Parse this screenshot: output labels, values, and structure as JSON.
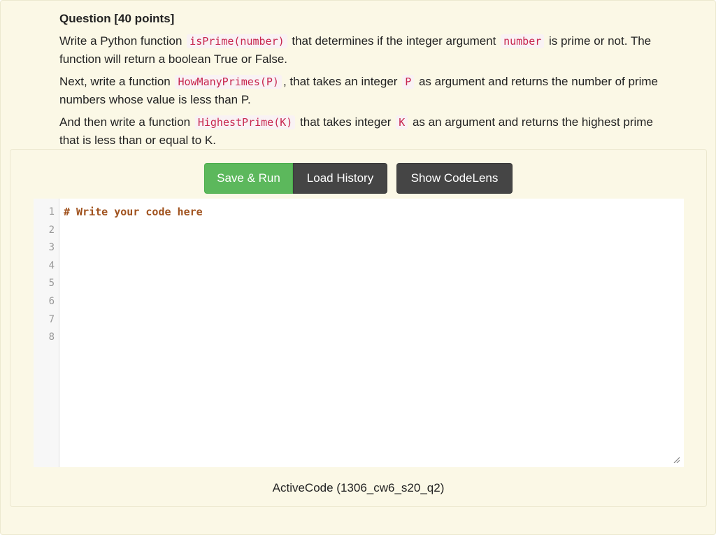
{
  "question": {
    "title": "Question [40 points]",
    "para1": {
      "t1": "Write a Python function ",
      "c1": "isPrime(number)",
      "t2": " that determines if the integer argument ",
      "c2": "number",
      "t3": " is prime or not. The function will return a boolean True or False."
    },
    "para2": {
      "t1": "Next, write a function ",
      "c1": "HowManyPrimes(P)",
      "t2": ", that takes an integer ",
      "c2": "P",
      "t3": " as argument and returns the number of prime numbers whose value is less than P."
    },
    "para3": {
      "t1": "And then write a function ",
      "c1": "HighestPrime(K)",
      "t2": " that takes integer ",
      "c2": "K",
      "t3": " as an argument and returns the highest prime that is less than or equal to K."
    }
  },
  "toolbar": {
    "save_run_label": "Save & Run",
    "load_history_label": "Load History",
    "show_codelens_label": "Show CodeLens"
  },
  "editor": {
    "line_numbers": [
      "1",
      "2",
      "3",
      "4",
      "5",
      "6",
      "7",
      "8"
    ],
    "lines": [
      "# Write your code here",
      "",
      "",
      "",
      "",
      "",
      "",
      ""
    ]
  },
  "caption": "ActiveCode (1306_cw6_s20_q2)",
  "colors": {
    "background": "#fbf8e6",
    "save_run": "#5cb85c",
    "dark_button": "#454545",
    "inline_code": "#c7254e",
    "comment": "#a0521e"
  }
}
